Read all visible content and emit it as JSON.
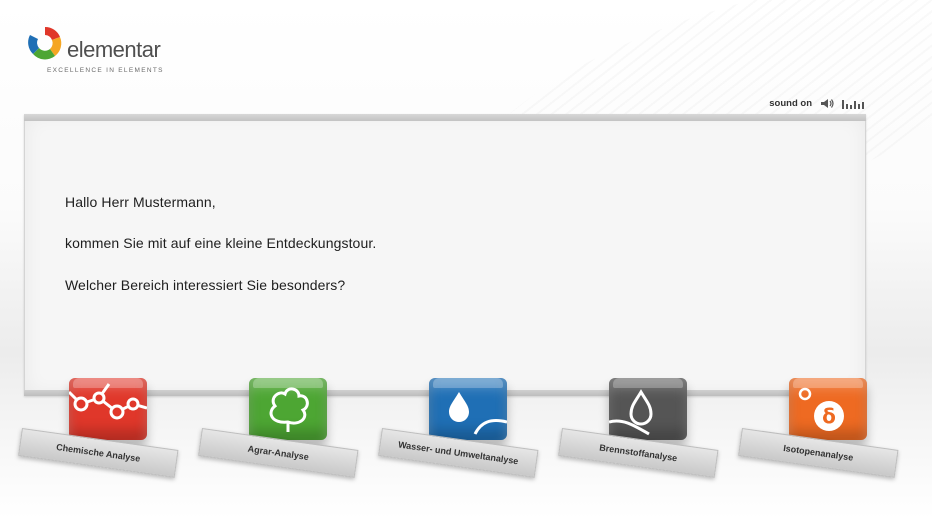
{
  "brand": {
    "name": "elementar",
    "tagline": "EXCELLENCE IN ELEMENTS"
  },
  "sound": {
    "label": "sound on"
  },
  "greeting": {
    "line1": "Hallo Herr Mustermann,",
    "line2": "kommen Sie mit auf eine kleine Entdeckungstour.",
    "line3": "Welcher Bereich interessiert Sie besonders?"
  },
  "categories": [
    {
      "label": "Chemische Analyse",
      "color": "#e0372a",
      "icon": "molecule-icon"
    },
    {
      "label": "Agrar-Analyse",
      "color": "#4da633",
      "icon": "tree-icon"
    },
    {
      "label": "Wasser- und Umweltanalyse",
      "color": "#1f6fb5",
      "icon": "water-drop-icon"
    },
    {
      "label": "Brennstoffanalyse",
      "color": "#555555",
      "icon": "fuel-drop-icon"
    },
    {
      "label": "Isotopenanalyse",
      "color": "#ee6a22",
      "icon": "delta-icon"
    }
  ]
}
